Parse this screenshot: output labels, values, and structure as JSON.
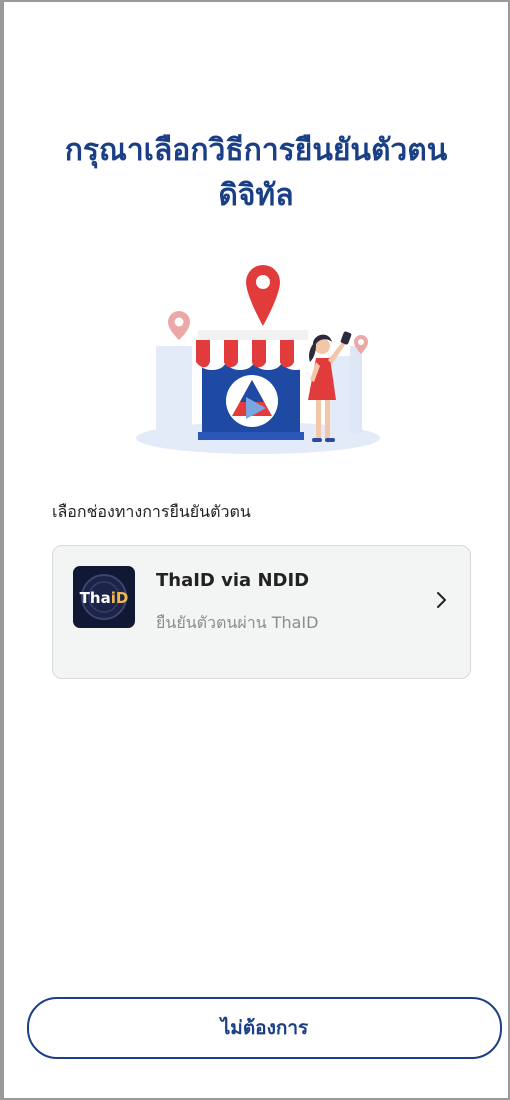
{
  "header": {
    "title_line1": "กรุณาเลือกวิธีการยืนยันตัวตน",
    "title_line2": "ดิจิทัล"
  },
  "illustration": {
    "icon": "storefront-selfie-illustration"
  },
  "section": {
    "label": "เลือกช่องทางการยืนยันตัวตน"
  },
  "channels": [
    {
      "logo_text": "ThaiD",
      "title": "ThaID via NDID",
      "subtitle": "ยืนยันตัวตนผ่าน ThaID",
      "icon": "chevron-right-icon"
    }
  ],
  "footer": {
    "decline_label": "ไม่ต้องการ"
  },
  "colors": {
    "primary": "#1a3f86",
    "card_bg": "#f3f4f4",
    "accent_red": "#e23b3b"
  }
}
